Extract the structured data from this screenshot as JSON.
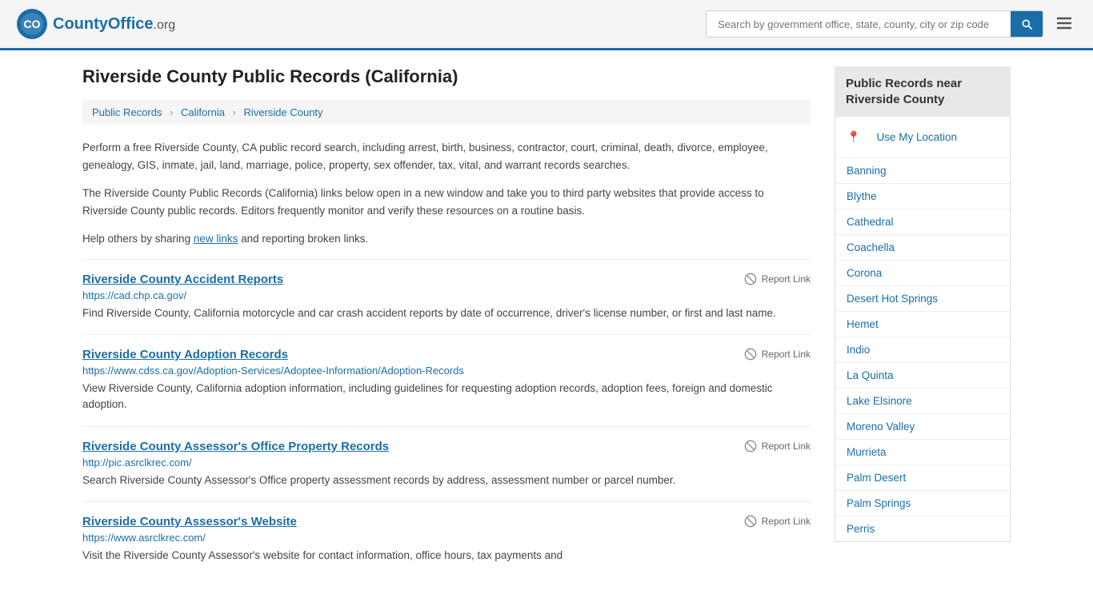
{
  "header": {
    "logo_text": "CountyOffice",
    "logo_suffix": ".org",
    "search_placeholder": "Search by government office, state, county, city or zip code",
    "search_value": ""
  },
  "page": {
    "title": "Riverside County Public Records (California)",
    "breadcrumb": [
      {
        "label": "Public Records",
        "href": "#"
      },
      {
        "label": "California",
        "href": "#"
      },
      {
        "label": "Riverside County",
        "href": "#"
      }
    ],
    "description1": "Perform a free Riverside County, CA public record search, including arrest, birth, business, contractor, court, criminal, death, divorce, employee, genealogy, GIS, inmate, jail, land, marriage, police, property, sex offender, tax, vital, and warrant records searches.",
    "description2": "The Riverside County Public Records (California) links below open in a new window and take you to third party websites that provide access to Riverside County public records. Editors frequently monitor and verify these resources on a routine basis.",
    "description3_pre": "Help others by sharing ",
    "description3_link": "new links",
    "description3_post": " and reporting broken links.",
    "report_label": "Report Link"
  },
  "records": [
    {
      "title": "Riverside County Accident Reports",
      "url": "https://cad.chp.ca.gov/",
      "description": "Find Riverside County, California motorcycle and car crash accident reports by date of occurrence, driver's license number, or first and last name."
    },
    {
      "title": "Riverside County Adoption Records",
      "url": "https://www.cdss.ca.gov/Adoption-Services/Adoptee-Information/Adoption-Records",
      "description": "View Riverside County, California adoption information, including guidelines for requesting adoption records, adoption fees, foreign and domestic adoption."
    },
    {
      "title": "Riverside County Assessor's Office Property Records",
      "url": "http://pic.asrclkrec.com/",
      "description": "Search Riverside County Assessor's Office property assessment records by address, assessment number or parcel number."
    },
    {
      "title": "Riverside County Assessor's Website",
      "url": "https://www.asrclkrec.com/",
      "description": "Visit the Riverside County Assessor's website for contact information, office hours, tax payments and"
    }
  ],
  "sidebar": {
    "title": "Public Records near Riverside County",
    "use_location_label": "Use My Location",
    "links": [
      "Banning",
      "Blythe",
      "Cathedral",
      "Coachella",
      "Corona",
      "Desert Hot Springs",
      "Hemet",
      "Indio",
      "La Quinta",
      "Lake Elsinore",
      "Moreno Valley",
      "Murrieta",
      "Palm Desert",
      "Palm Springs",
      "Perris"
    ]
  }
}
